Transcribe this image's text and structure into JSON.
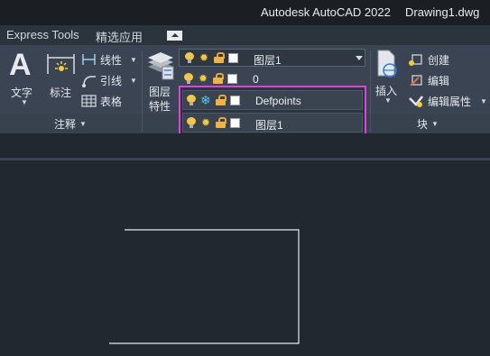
{
  "title_bar": {
    "app_title": "Autodesk AutoCAD 2022",
    "document": "Drawing1.dwg"
  },
  "tabs": [
    {
      "label": "Express Tools"
    },
    {
      "label": "精选应用"
    }
  ],
  "ribbon": {
    "annotation_panel": {
      "text_label": "文字",
      "dimension_label": "标注",
      "linear_label": "线性",
      "leader_label": "引线",
      "table_label": "表格",
      "panel_title": "注释"
    },
    "layers_panel": {
      "layer_properties_label": "图层\n特性",
      "layer_props_line1": "图层",
      "layer_props_line2": "特性",
      "current_layer": "图层1",
      "layer_rows": [
        {
          "name": "0"
        }
      ],
      "dropdown_items": [
        {
          "name": "Defpoints",
          "frozen": true
        },
        {
          "name": "图层1",
          "frozen": false
        }
      ]
    },
    "block_panel": {
      "insert_label": "插入",
      "create_label": "创建",
      "edit_label": "编辑",
      "edit_attributes_label": "编辑属性",
      "panel_title": "块"
    }
  },
  "colors": {
    "dropdown_highlight": "#e040e0",
    "ribbon_bg": "#3b4452",
    "drawing_bg": "#212830"
  }
}
